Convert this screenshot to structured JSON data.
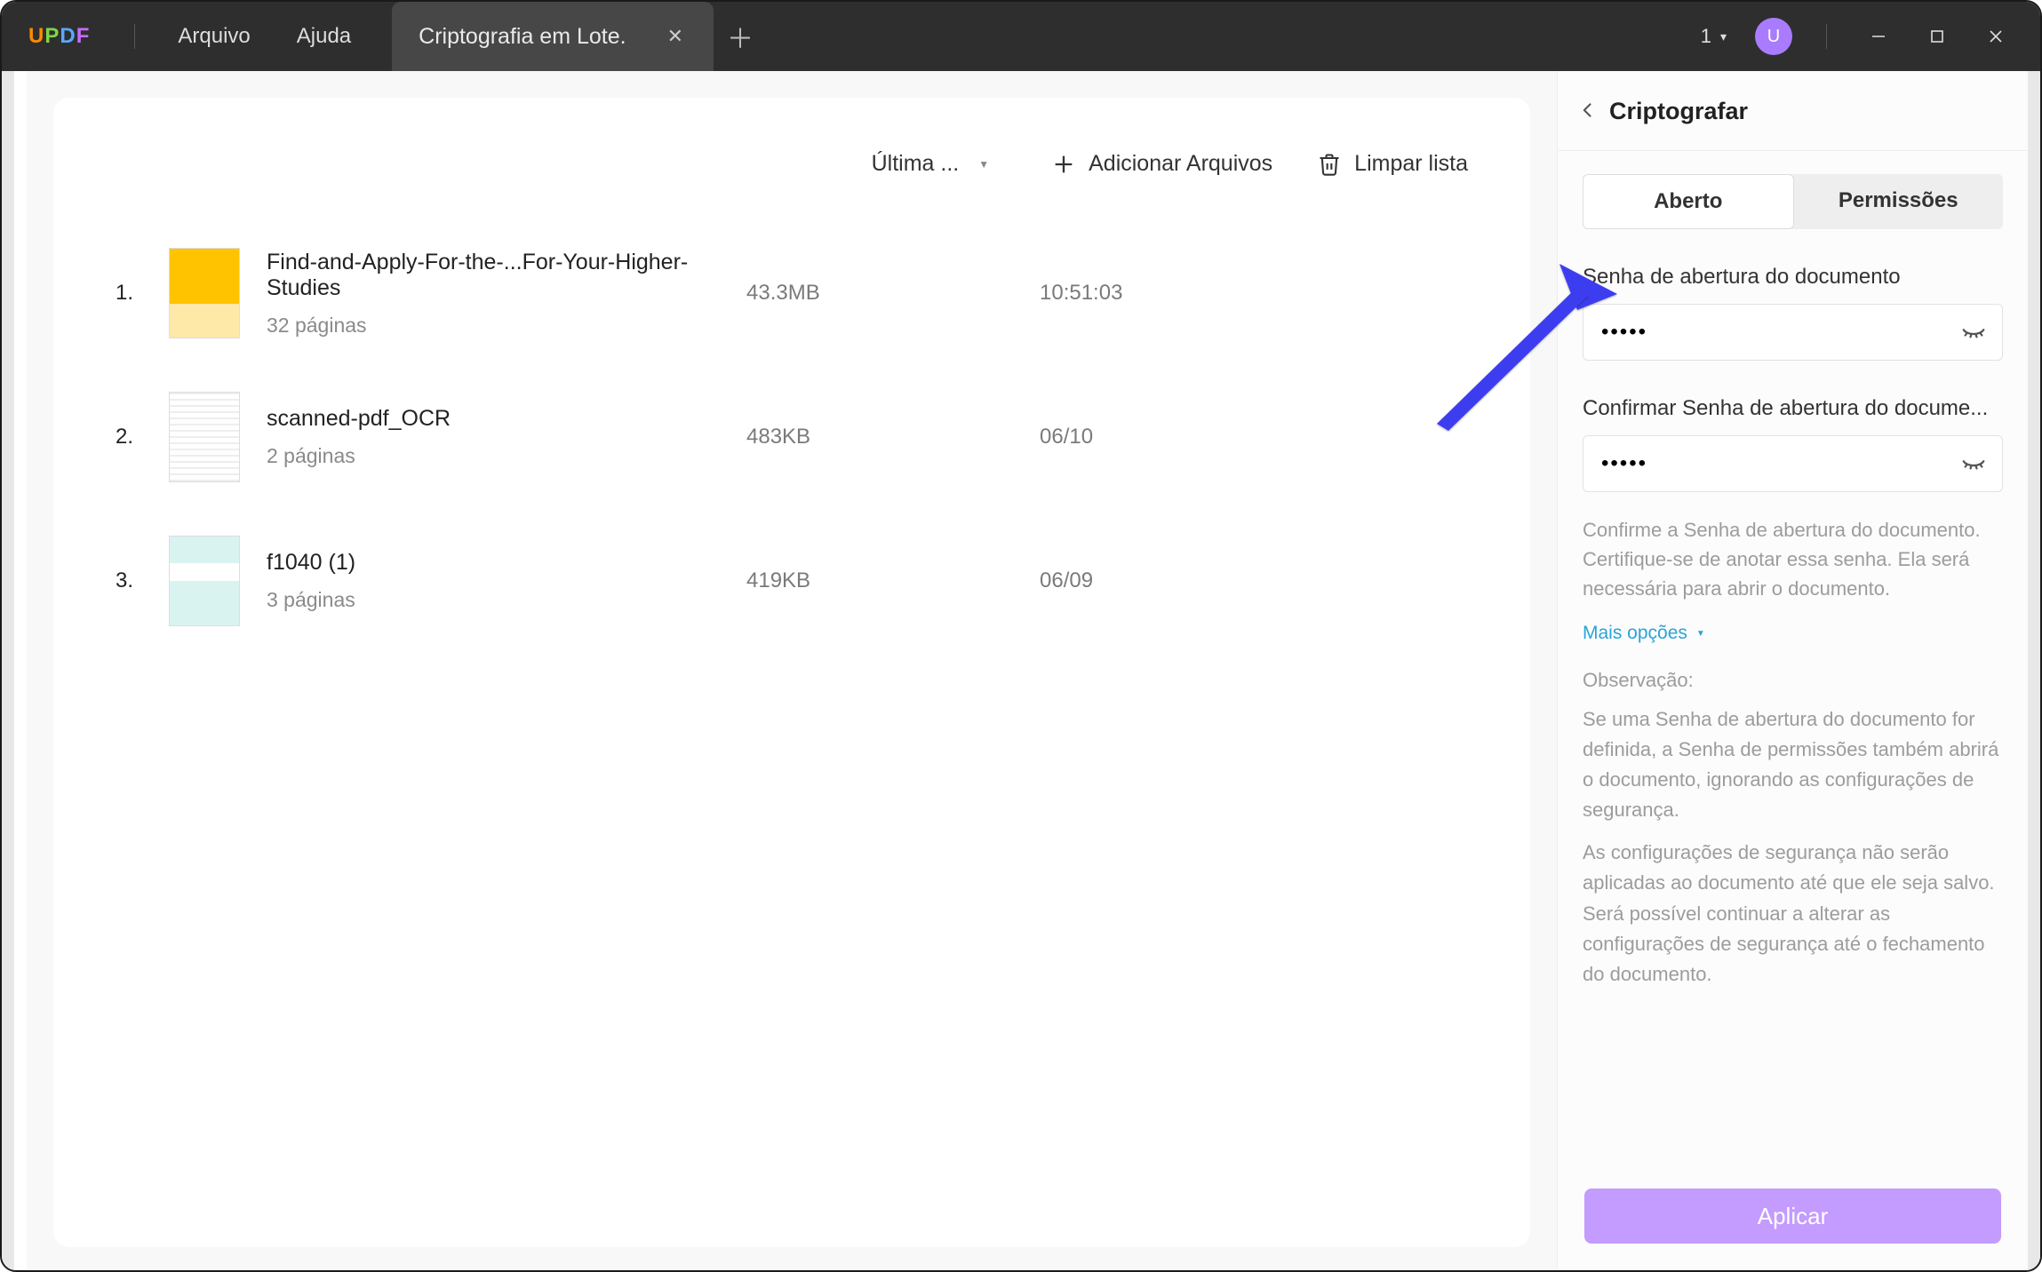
{
  "titlebar": {
    "logo": {
      "u": "U",
      "p": "P",
      "d": "D",
      "f": "F"
    },
    "menu_file": "Arquivo",
    "menu_help": "Ajuda",
    "tab_label": "Criptografia em Lote.",
    "count_badge": "1",
    "avatar_initial": "U"
  },
  "toolbar": {
    "sort_label": "Última ...",
    "add_label": "Adicionar Arquivos",
    "clear_label": "Limpar lista"
  },
  "files": [
    {
      "idx": "1.",
      "name": "Find-and-Apply-For-the-...For-Your-Higher-Studies",
      "pages": "32 páginas",
      "size": "43.3MB",
      "time": "10:51:03"
    },
    {
      "idx": "2.",
      "name": "scanned-pdf_OCR",
      "pages": "2 páginas",
      "size": "483KB",
      "time": "06/10"
    },
    {
      "idx": "3.",
      "name": "f1040 (1)",
      "pages": "3 páginas",
      "size": "419KB",
      "time": "06/09"
    }
  ],
  "panel": {
    "title": "Criptografar",
    "tab_open": "Aberto",
    "tab_perm": "Permissões",
    "open_pw_label": "Senha de abertura do documento",
    "confirm_pw_label": "Confirmar Senha de abertura do docume...",
    "pw_value": "•••••",
    "hint": "Confirme a Senha de abertura do documento. Certifique-se de anotar essa senha. Ela será necessária para abrir o documento.",
    "more": "Mais opções",
    "observation_title": "Observação:",
    "observation1": "Se uma Senha de abertura do documento for definida, a Senha de permissões também abrirá o documento, ignorando as configurações de segurança.",
    "observation2": "As configurações de segurança não serão aplicadas ao documento até que ele seja salvo. Será possível continuar a alterar as configurações de segurança até o fechamento do documento.",
    "apply": "Aplicar"
  }
}
